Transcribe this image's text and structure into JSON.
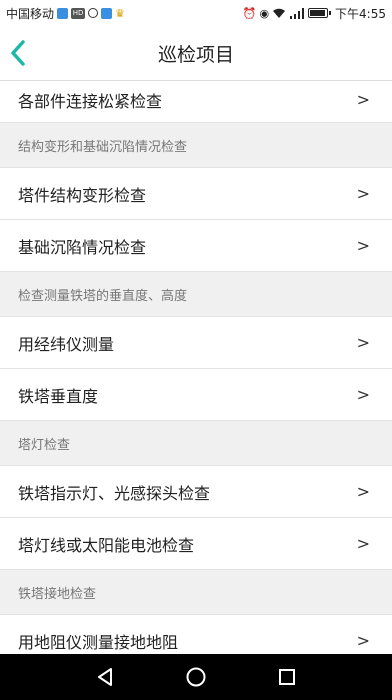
{
  "status": {
    "carrier": "中国移动",
    "time": "下午4:55",
    "network": "4G"
  },
  "header": {
    "title": "巡检项目"
  },
  "list": [
    {
      "type": "item",
      "label": "各部件连接松紧检查",
      "chevron": ">"
    },
    {
      "type": "section",
      "label": "结构变形和基础沉陷情况检查"
    },
    {
      "type": "item",
      "label": "塔件结构变形检查",
      "chevron": ">"
    },
    {
      "type": "item",
      "label": "基础沉陷情况检查",
      "chevron": ">"
    },
    {
      "type": "section",
      "label": "检查测量铁塔的垂直度、高度"
    },
    {
      "type": "item",
      "label": "用经纬仪测量",
      "chevron": ">"
    },
    {
      "type": "item",
      "label": "铁塔垂直度",
      "chevron": ">"
    },
    {
      "type": "section",
      "label": "塔灯检查"
    },
    {
      "type": "item",
      "label": "铁塔指示灯、光感探头检查",
      "chevron": ">"
    },
    {
      "type": "item",
      "label": "塔灯线或太阳能电池检查",
      "chevron": ">"
    },
    {
      "type": "section",
      "label": "铁塔接地检查"
    },
    {
      "type": "item",
      "label": "用地阻仪测量接地地阻",
      "chevron": ">"
    }
  ],
  "colors": {
    "accent": "#1fb8a8",
    "section_bg": "#f0f0f0",
    "navbar": "#000000"
  },
  "icons": {
    "back": "chevron-left-icon",
    "nav_back": "triangle-back-icon",
    "nav_home": "circle-home-icon",
    "nav_recent": "square-recent-icon"
  }
}
